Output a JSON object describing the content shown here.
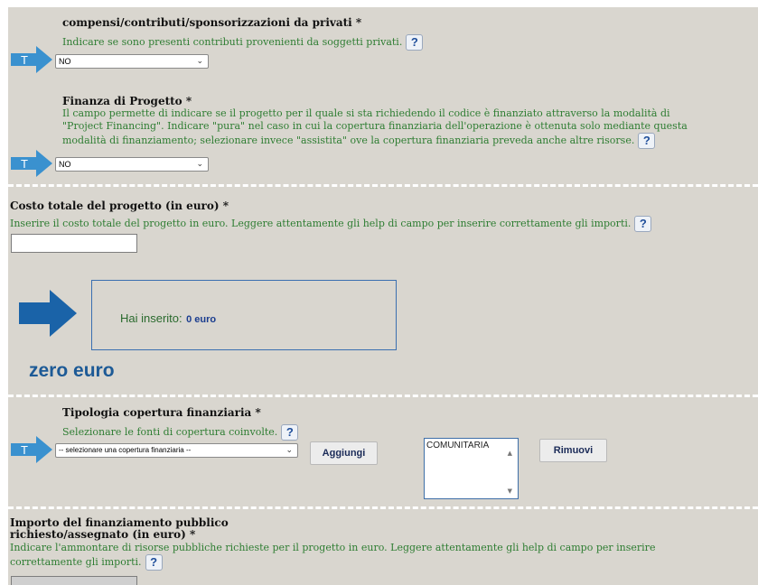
{
  "sections": {
    "privati": {
      "title": "compensi/contributi/sponsorizzazioni da privati *",
      "help": "Indicare se sono presenti contributi provenienti da soggetti privati.",
      "select_value": "NO",
      "arrow_letter": "T"
    },
    "finanza": {
      "title": "Finanza di Progetto *",
      "help_lines": [
        "Il campo permette di indicare se il progetto per il quale si sta richiedendo il codice è finanziato attraverso la modalità di",
        "\"Project Financing\". Indicare \"pura\" nel caso in cui la copertura finanziaria dell'operazione è ottenuta solo mediante questa",
        "modalità di finanziamento; selezionare invece \"assistita\" ove la copertura finanziaria preveda anche altre risorse."
      ],
      "select_value": "NO",
      "arrow_letter": "T"
    },
    "costo": {
      "title": "Costo totale del progetto (in euro) *",
      "help": "Inserire il costo totale del progetto in euro. Leggere attentamente gli help di campo per inserire correttamente gli importi.",
      "input_value": ""
    },
    "hai_inserito": {
      "label": "Hai inserito:",
      "value": "0 euro",
      "caption": "zero euro"
    },
    "tipologia": {
      "title": "Tipologia copertura finanziaria *",
      "help": "Selezionare le fonti di copertura coinvolte.",
      "select_value": "-- selezionare una copertura finanziaria --",
      "add_button": "Aggiungi",
      "list_items": [
        "COMUNITARIA"
      ],
      "remove_button": "Rimuovi",
      "arrow_letter": "T"
    },
    "importo": {
      "title_lines": [
        "Importo del finanziamento pubblico",
        "richiesto/assegnato (in euro) *"
      ],
      "help_lines": [
        "Indicare l'ammontare di risorse pubbliche richieste per il progetto in euro. Leggere attentamente gli help di campo per inserire",
        "correttamente gli importi."
      ]
    }
  },
  "help_icon_glyph": "?",
  "colors": {
    "panel_bg": "#d9d6cf",
    "help_text": "#2e7d32",
    "arrow_blue": "#3a91cf",
    "big_arrow": "#1a63a8",
    "caption_blue": "#1d5a96",
    "value_blue": "#1b3d8f"
  }
}
